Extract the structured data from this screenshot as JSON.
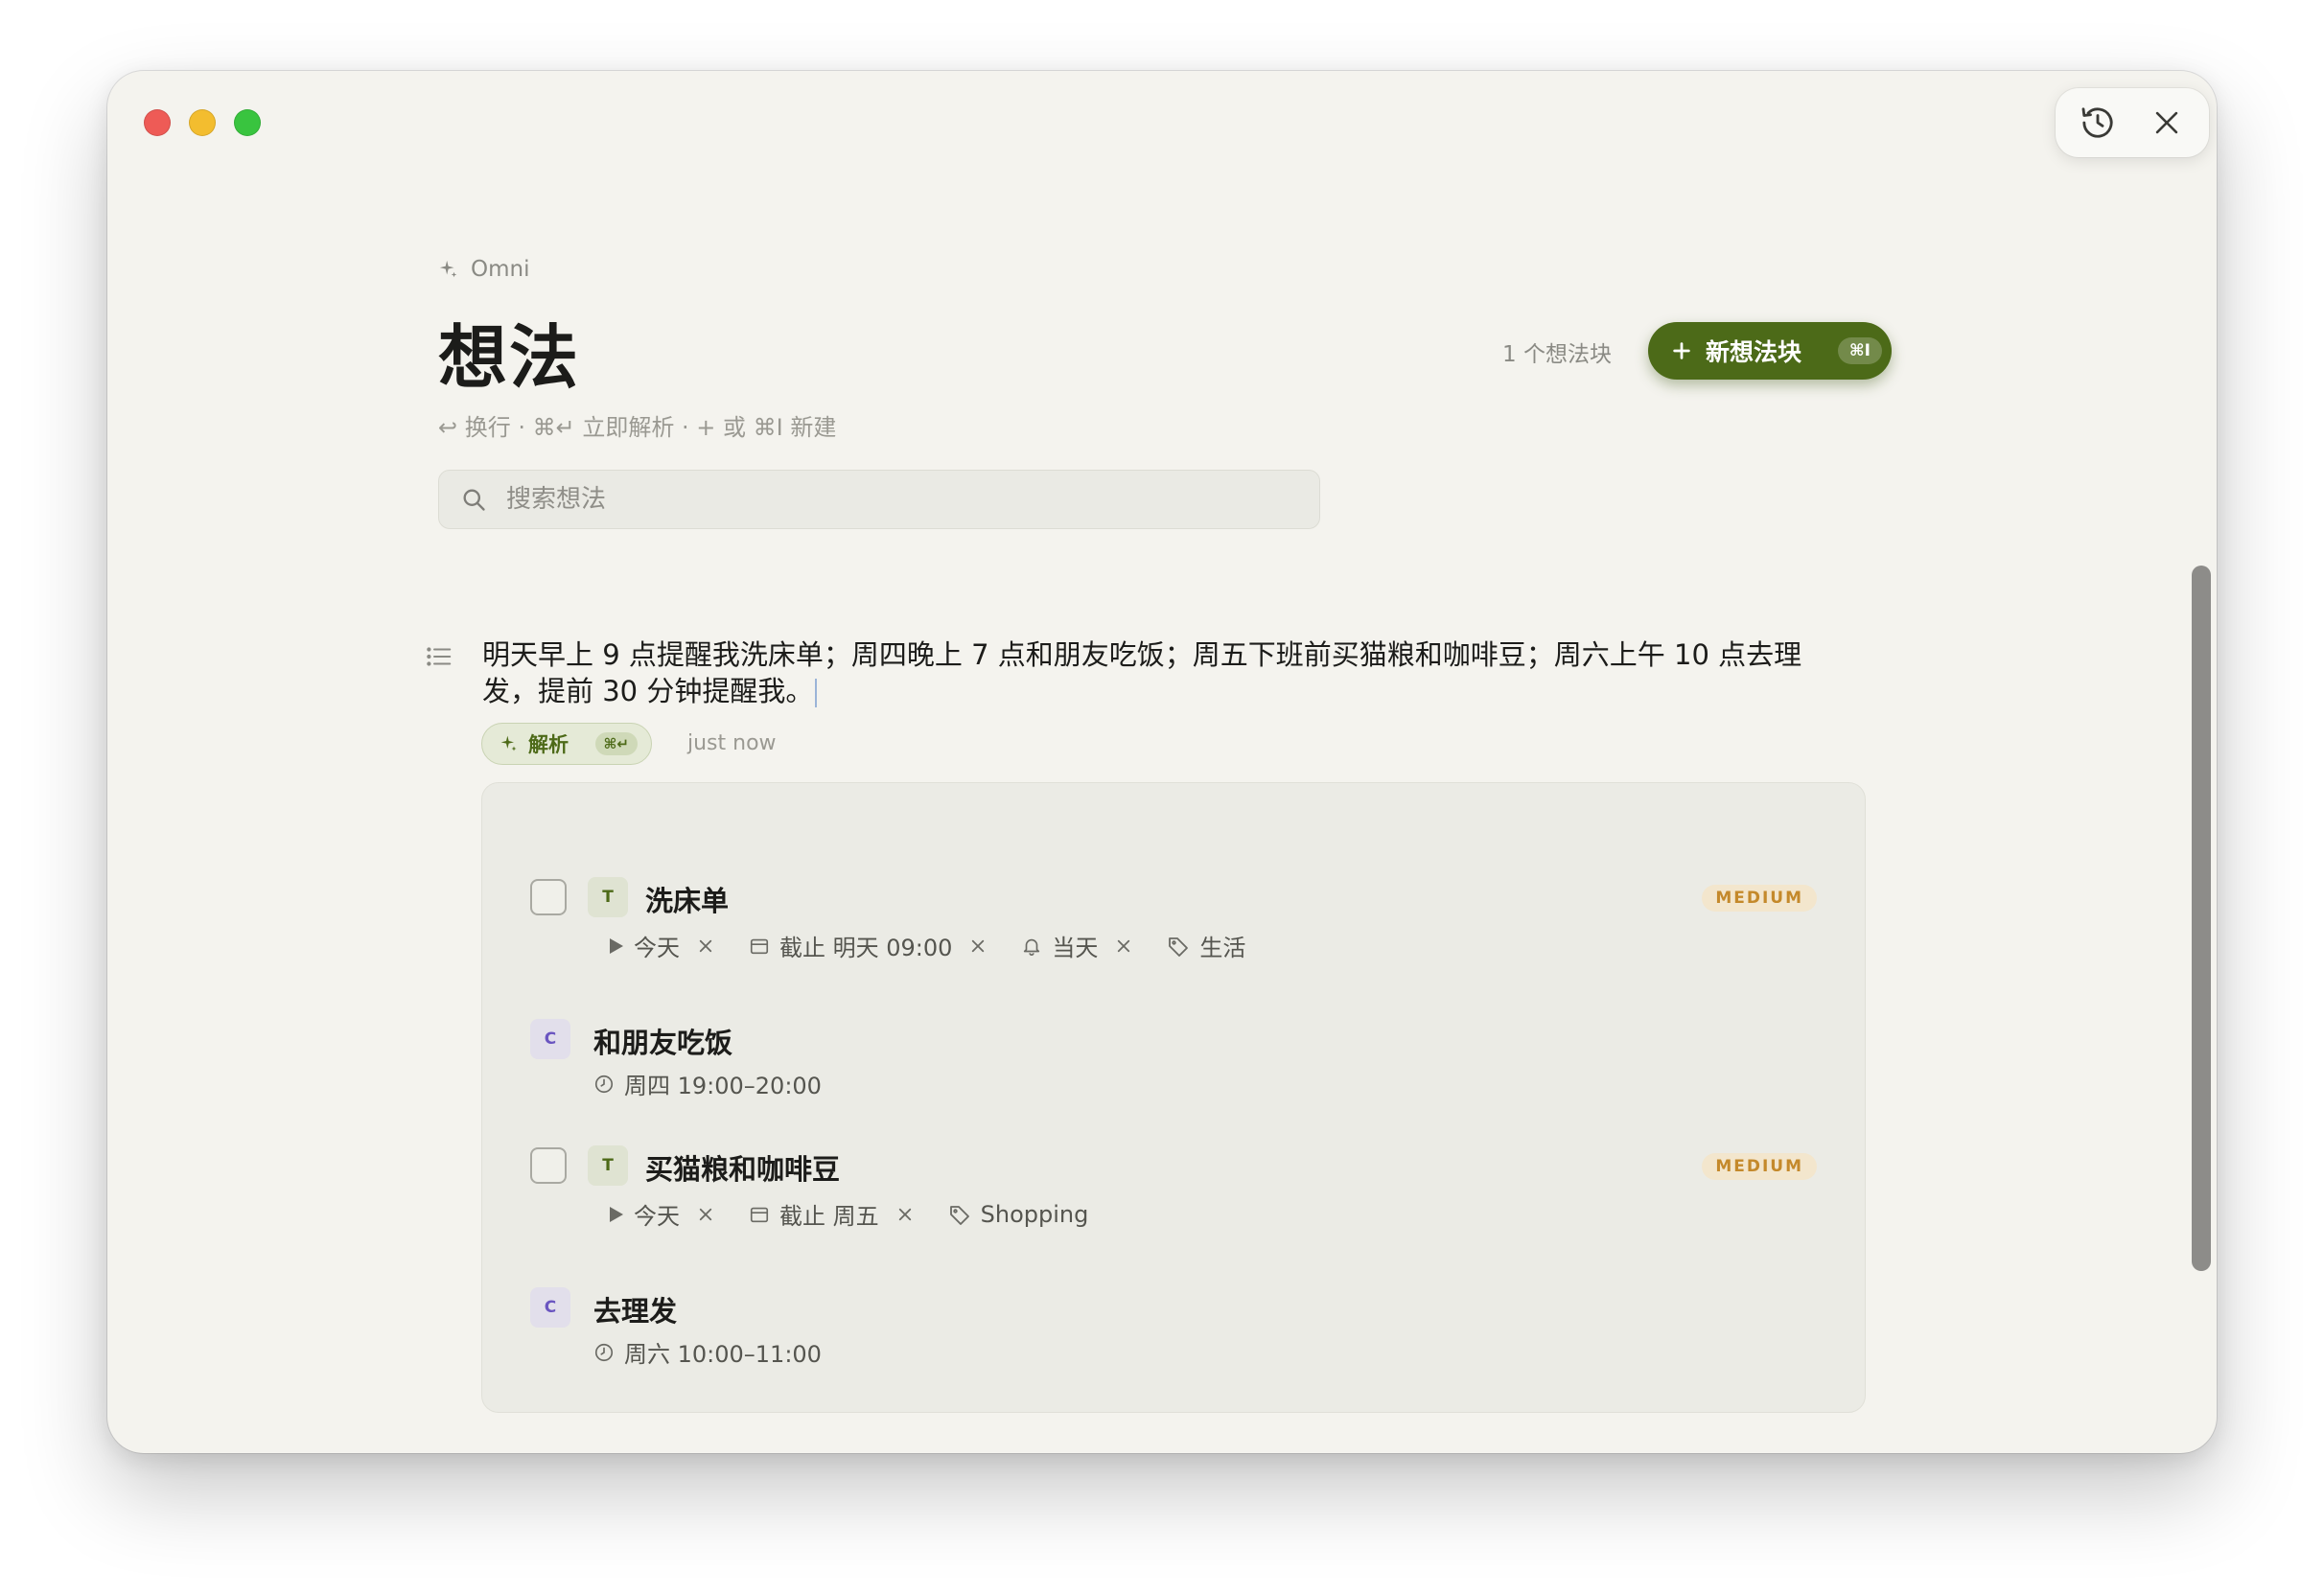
{
  "window": {
    "icons": {
      "history": "history-icon",
      "close": "close-icon"
    }
  },
  "header": {
    "brand": "Omni",
    "title": "想法",
    "hint": "↩ 换行 · ⌘↵ 立即解析 · + 或 ⌘I 新建",
    "count": "1 个想法块",
    "new_button": {
      "label": "新想法块",
      "shortcut": "⌘I"
    }
  },
  "search": {
    "placeholder": "搜索想法",
    "value": ""
  },
  "block": {
    "text": "明天早上 9 点提醒我洗床单；周四晚上 7 点和朋友吃饭；周五下班前买猫粮和咖啡豆；周六上午 10 点去理发，提前 30 分钟提醒我。",
    "parse_label": "解析",
    "parse_shortcut": "⌘↵",
    "time": "just now"
  },
  "items": [
    {
      "kind": "task",
      "badge": "T",
      "title": "洗床单",
      "priority": "MEDIUM",
      "start": "今天",
      "due": "截止 明天 09:00",
      "reminder": "当天",
      "tag": "生活"
    },
    {
      "kind": "calendar",
      "badge": "C",
      "title": "和朋友吃饭",
      "time": "周四 19:00–20:00"
    },
    {
      "kind": "task",
      "badge": "T",
      "title": "买猫粮和咖啡豆",
      "priority": "MEDIUM",
      "start": "今天",
      "due": "截止 周五",
      "tag": "Shopping"
    },
    {
      "kind": "calendar",
      "badge": "C",
      "title": "去理发",
      "time": "周六 10:00–11:00"
    }
  ],
  "colors": {
    "accent": "#4c6a18",
    "background": "#f4f3ee",
    "priority_text": "#c4892b",
    "priority_bg": "#f3e6cd",
    "calendar_badge": "#6a55c0"
  }
}
